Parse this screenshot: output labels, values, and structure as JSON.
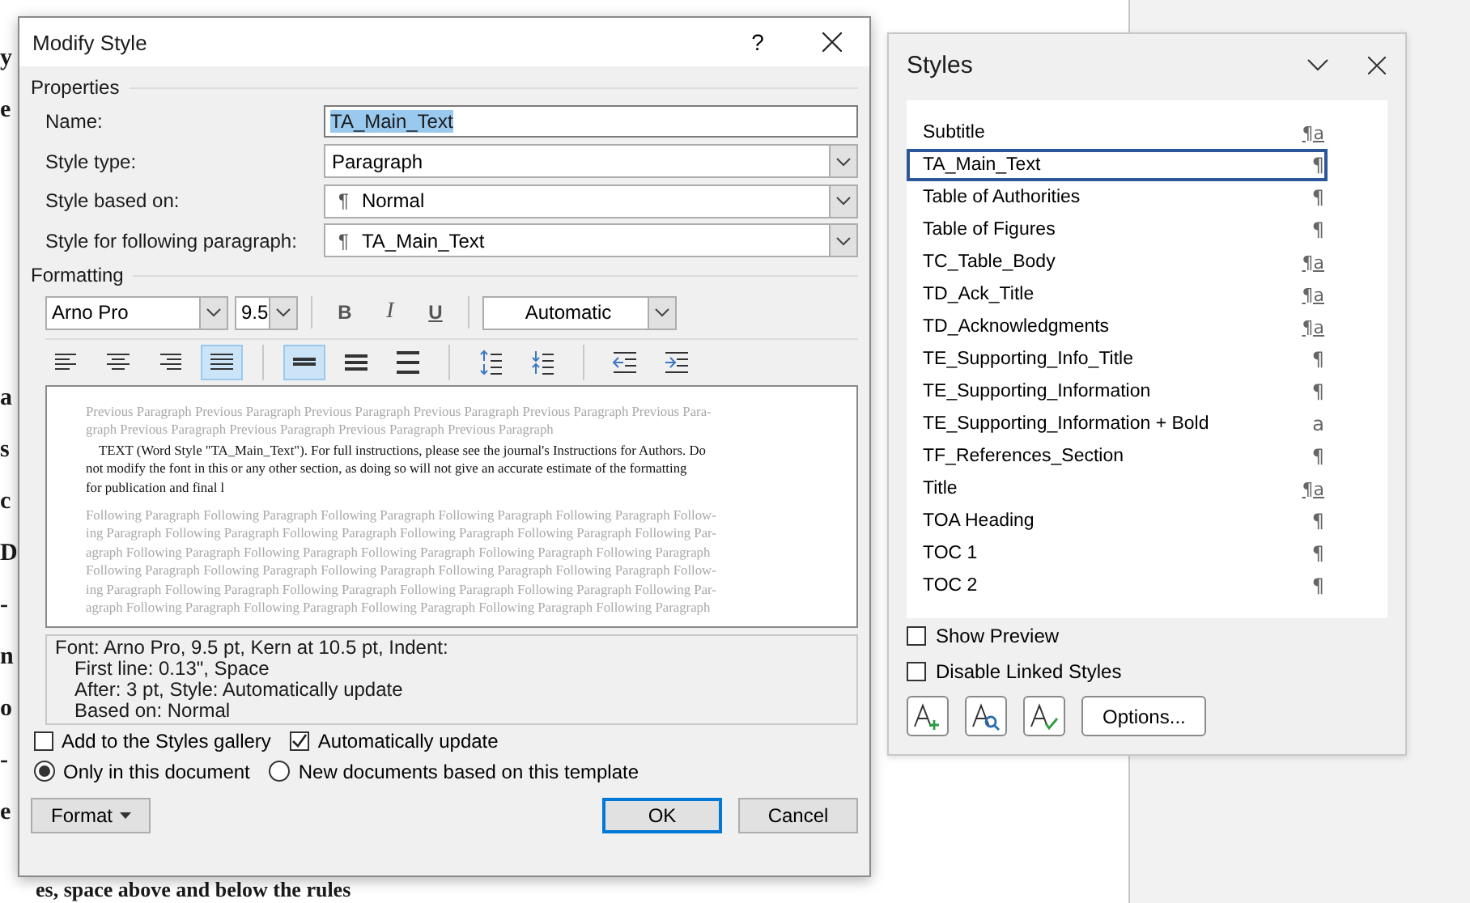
{
  "document": {
    "margin_text_top": [
      "y",
      "e"
    ],
    "margin_text_lower": [
      "a",
      "s",
      "c",
      "D",
      "-",
      "n",
      "o",
      "-",
      "e"
    ],
    "bottom_line": "es, space above and below the rules"
  },
  "dialog": {
    "title": "Modify Style",
    "help": "?",
    "properties_heading": "Properties",
    "fields": [
      {
        "label": "Name:",
        "kind": "text",
        "value": "TA_Main_Text",
        "highlighted": true
      },
      {
        "label": "Style type:",
        "kind": "combo",
        "value": "Paragraph"
      },
      {
        "label": "Style based on:",
        "kind": "combo",
        "marker": "¶",
        "value": "Normal"
      },
      {
        "label": "Style for following paragraph:",
        "kind": "combo",
        "marker": "¶",
        "value": "TA_Main_Text"
      }
    ],
    "formatting_heading": "Formatting",
    "font": "Arno Pro",
    "size": "9.5",
    "bold": "B",
    "italic": "I",
    "underline": "U",
    "font_color": "Automatic",
    "tools": [
      {
        "kind": "align-left",
        "selected": false
      },
      {
        "kind": "align-center",
        "selected": false
      },
      {
        "kind": "align-right",
        "selected": false
      },
      {
        "kind": "justify",
        "selected": true
      },
      {
        "kind": "sep"
      },
      {
        "kind": "single-spacing",
        "selected": true
      },
      {
        "kind": "one-half-spacing",
        "selected": false
      },
      {
        "kind": "double-spacing",
        "selected": false
      },
      {
        "kind": "sep"
      },
      {
        "kind": "space-before",
        "selected": false
      },
      {
        "kind": "space-after",
        "selected": false
      },
      {
        "kind": "sep"
      },
      {
        "kind": "outdent",
        "selected": false
      },
      {
        "kind": "indent",
        "selected": false
      }
    ],
    "preview": {
      "previous": [
        "Previous Paragraph Previous Paragraph Previous Paragraph Previous Paragraph Previous Paragraph Previous Para-",
        "graph Previous Paragraph Previous Paragraph Previous Paragraph Previous Paragraph"
      ],
      "sample": [
        "TEXT (Word Style \"TA_Main_Text\"). For full instructions, please see the journal's Instructions for Authors.  Do",
        "not modify the font in this or any other section, as doing so will not give an accurate estimate of the formatting",
        "for publication and final l"
      ],
      "following": [
        "Following Paragraph Following Paragraph Following Paragraph Following Paragraph Following Paragraph Follow-",
        "ing Paragraph Following Paragraph Following Paragraph Following Paragraph Following Paragraph Following Par-",
        "agraph Following Paragraph Following Paragraph Following Paragraph Following Paragraph Following Paragraph",
        "Following Paragraph Following Paragraph Following Paragraph Following Paragraph Following Paragraph Follow-",
        "ing Paragraph Following Paragraph Following Paragraph Following Paragraph Following Paragraph Following Par-",
        "agraph Following Paragraph Following Paragraph Following Paragraph Following Paragraph Following Paragraph"
      ]
    },
    "description": [
      "Font: Arno Pro, 9.5 pt, Kern at 10.5 pt, Indent:",
      "First line:  0.13\", Space",
      "After:  3 pt, Style: Automatically update",
      "Based on: Normal"
    ],
    "checkboxes": [
      {
        "label": "Add to the Styles gallery",
        "checked": false
      },
      {
        "label": "Automatically update",
        "checked": true
      }
    ],
    "radios": [
      {
        "label": "Only in this document",
        "selected": true
      },
      {
        "label": "New documents based on this template",
        "selected": false
      }
    ],
    "format_button": "Format",
    "buttons": [
      {
        "label": "OK",
        "default": true
      },
      {
        "label": "Cancel",
        "default": false
      }
    ]
  },
  "styles_pane": {
    "title": "Styles",
    "items": [
      {
        "name": "Subtitle",
        "kind": "linked",
        "type_mark": "¶a",
        "selected": false
      },
      {
        "name": "TA_Main_Text",
        "kind": "paragraph",
        "type_mark": "¶",
        "selected": true
      },
      {
        "name": "Table of Authorities",
        "kind": "paragraph",
        "type_mark": "¶",
        "selected": false
      },
      {
        "name": "Table of Figures",
        "kind": "paragraph",
        "type_mark": "¶",
        "selected": false
      },
      {
        "name": "TC_Table_Body",
        "kind": "linked",
        "type_mark": "¶a",
        "selected": false
      },
      {
        "name": "TD_Ack_Title",
        "kind": "linked",
        "type_mark": "¶a",
        "selected": false
      },
      {
        "name": "TD_Acknowledgments",
        "kind": "linked",
        "type_mark": "¶a",
        "selected": false
      },
      {
        "name": "TE_Supporting_Info_Title",
        "kind": "paragraph",
        "type_mark": "¶",
        "selected": false
      },
      {
        "name": "TE_Supporting_Information",
        "kind": "paragraph",
        "type_mark": "¶",
        "selected": false
      },
      {
        "name": "TE_Supporting_Information + Bold",
        "kind": "character",
        "type_mark": "a",
        "selected": false
      },
      {
        "name": "TF_References_Section",
        "kind": "paragraph",
        "type_mark": "¶",
        "selected": false
      },
      {
        "name": "Title",
        "kind": "linked",
        "type_mark": "¶a",
        "selected": false
      },
      {
        "name": "TOA Heading",
        "kind": "paragraph",
        "type_mark": "¶",
        "selected": false
      },
      {
        "name": "TOC 1",
        "kind": "paragraph",
        "type_mark": "¶",
        "selected": false
      },
      {
        "name": "TOC 2",
        "kind": "paragraph",
        "type_mark": "¶",
        "selected": false
      }
    ],
    "options": [
      {
        "label": "Show Preview",
        "checked": false
      },
      {
        "label": "Disable Linked Styles",
        "checked": false
      }
    ],
    "tools": [
      {
        "kind": "new-style"
      },
      {
        "kind": "inspect"
      },
      {
        "kind": "manage"
      }
    ],
    "options_button": "Options..."
  }
}
